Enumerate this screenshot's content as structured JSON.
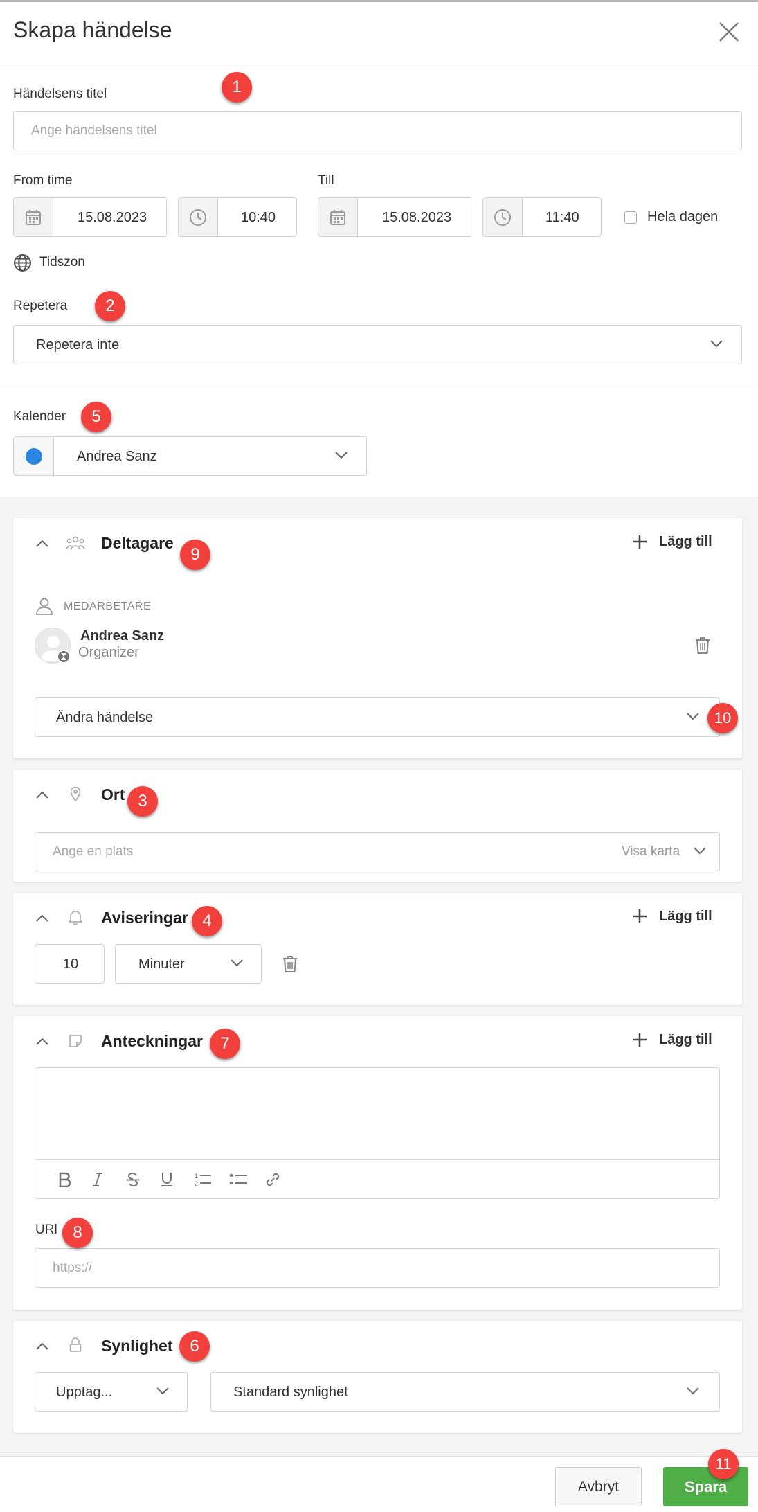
{
  "dialog": {
    "title": "Skapa händelse"
  },
  "event_title": {
    "label": "Händelsens titel",
    "placeholder": "Ange händelsens titel"
  },
  "time": {
    "from_label": "From time",
    "to_label": "Till",
    "from_date": "15.08.2023",
    "from_time": "10:40",
    "to_date": "15.08.2023",
    "to_time": "11:40",
    "all_day_label": "Hela dagen",
    "timezone_label": "Tidszon"
  },
  "repeat": {
    "label": "Repetera",
    "value": "Repetera inte"
  },
  "calendar": {
    "label": "Kalender",
    "value": "Andrea Sanz",
    "color": "#2b86e0"
  },
  "participants": {
    "title": "Deltagare",
    "add_label": "Lägg till",
    "group_label": "MEDARBETARE",
    "person_name": "Andrea Sanz",
    "person_role": "Organizer",
    "permission": "Ändra händelse"
  },
  "location": {
    "title": "Ort",
    "placeholder": "Ange en plats",
    "map_label": "Visa karta"
  },
  "notifications": {
    "title": "Aviseringar",
    "add_label": "Lägg till",
    "amount": "10",
    "unit": "Minuter"
  },
  "notes": {
    "title": "Anteckningar",
    "add_label": "Lägg till",
    "url_label": "URl",
    "url_placeholder": "https://"
  },
  "visibility": {
    "title": "Synlighet",
    "status": "Upptag...",
    "value": "Standard synlighet"
  },
  "footer": {
    "cancel_label": "Avbryt",
    "save_label": "Spara",
    "save_color": "#4fae47"
  },
  "badges": {
    "b1": "1",
    "b2": "2",
    "b3": "3",
    "b4": "4",
    "b5": "5",
    "b6": "6",
    "b7": "7",
    "b8": "8",
    "b9": "9",
    "b10": "10",
    "b11": "11"
  }
}
